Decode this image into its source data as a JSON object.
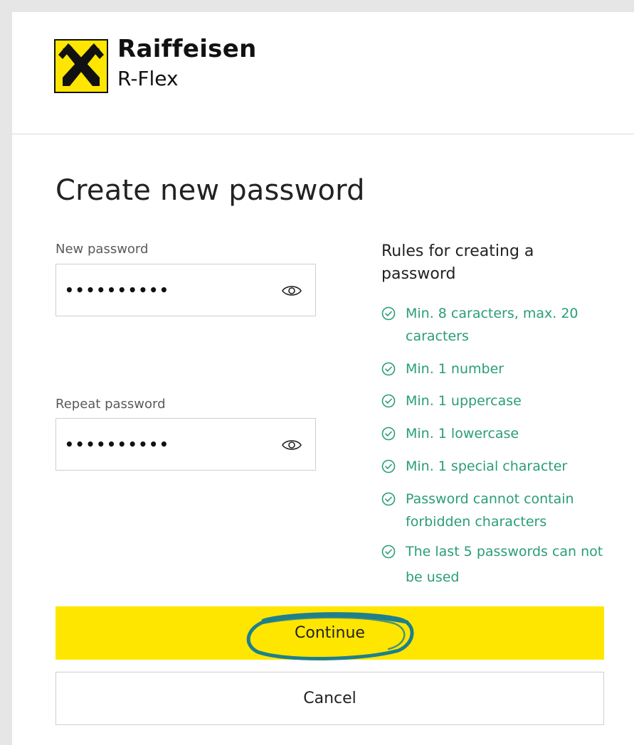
{
  "brand": {
    "name": "Raiffeisen",
    "product": "R-Flex"
  },
  "page": {
    "title": "Create new password"
  },
  "fields": {
    "new_password": {
      "label": "New password",
      "value": "••••••••••"
    },
    "repeat_password": {
      "label": "Repeat password",
      "value": "••••••••••"
    }
  },
  "rules": {
    "title": "Rules for creating a password",
    "items": [
      {
        "label": "Min. 8 caracters, max. 20 caracters",
        "met": true
      },
      {
        "label": "Min. 1 number",
        "met": true
      },
      {
        "label": "Min. 1 uppercase",
        "met": true
      },
      {
        "label": "Min. 1 lowercase",
        "met": true
      },
      {
        "label": "Min. 1 special character",
        "met": true
      },
      {
        "label": "Password cannot contain forbidden characters",
        "met": true
      },
      {
        "label": "The last 5 passwords can not be used",
        "met": true
      }
    ]
  },
  "actions": {
    "continue_label": "Continue",
    "cancel_label": "Cancel"
  },
  "colors": {
    "brand_yellow": "#ffe600",
    "rule_ok_green": "#2a9d78",
    "annotation_teal": "#1f7f8c"
  },
  "icons": {
    "logo": "raiffeisen-crossed-gables-logo",
    "show_password": "eye-icon",
    "rule_met": "check-circle-icon"
  }
}
